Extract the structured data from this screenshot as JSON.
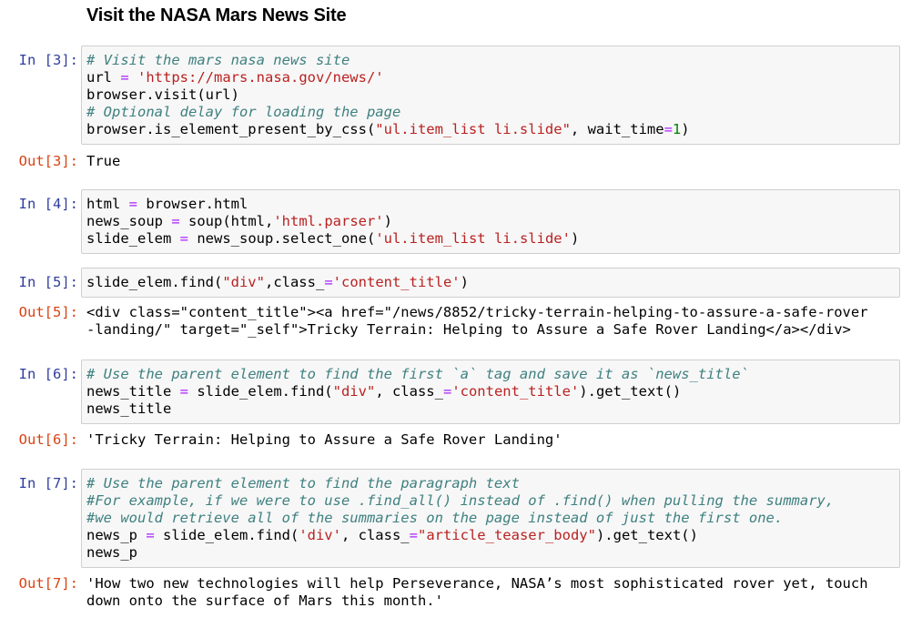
{
  "heading": "Visit the NASA Mars News Site",
  "cells": [
    {
      "in_prompt": "In [3]:",
      "code": [
        [
          {
            "t": "# Visit the mars nasa news site",
            "c": "cm"
          }
        ],
        [
          {
            "t": "url "
          },
          {
            "t": "=",
            "c": "op"
          },
          {
            "t": " "
          },
          {
            "t": "'https://mars.nasa.gov/news/'",
            "c": "st"
          }
        ],
        [
          {
            "t": "browser.visit(url)"
          }
        ],
        [
          {
            "t": "# Optional delay for loading the page",
            "c": "cm"
          }
        ],
        [
          {
            "t": "browser.is_element_present_by_css("
          },
          {
            "t": "\"ul.item_list li.slide\"",
            "c": "st"
          },
          {
            "t": ", wait_time"
          },
          {
            "t": "=",
            "c": "op"
          },
          {
            "t": "1",
            "c": "nm"
          },
          {
            "t": ")"
          }
        ]
      ],
      "out_prompt": "Out[3]:",
      "output": [
        "True"
      ]
    },
    {
      "in_prompt": "In [4]:",
      "code": [
        [
          {
            "t": "html "
          },
          {
            "t": "=",
            "c": "op"
          },
          {
            "t": " browser.html"
          }
        ],
        [
          {
            "t": "news_soup "
          },
          {
            "t": "=",
            "c": "op"
          },
          {
            "t": " soup(html,"
          },
          {
            "t": "'html.parser'",
            "c": "st"
          },
          {
            "t": ")"
          }
        ],
        [
          {
            "t": "slide_elem "
          },
          {
            "t": "=",
            "c": "op"
          },
          {
            "t": " news_soup.select_one("
          },
          {
            "t": "'ul.item_list li.slide'",
            "c": "st"
          },
          {
            "t": ")"
          }
        ]
      ],
      "out_prompt": "",
      "output": []
    },
    {
      "in_prompt": "In [5]:",
      "code": [
        [
          {
            "t": "slide_elem.find("
          },
          {
            "t": "\"div\"",
            "c": "st"
          },
          {
            "t": ",class_"
          },
          {
            "t": "=",
            "c": "op"
          },
          {
            "t": "'content_title'",
            "c": "st"
          },
          {
            "t": ")"
          }
        ]
      ],
      "out_prompt": "Out[5]:",
      "output": [
        "<div class=\"content_title\"><a href=\"/news/8852/tricky-terrain-helping-to-assure-a-safe-rover",
        "-landing/\" target=\"_self\">Tricky Terrain: Helping to Assure a Safe Rover Landing</a></div>"
      ]
    },
    {
      "in_prompt": "In [6]:",
      "code": [
        [
          {
            "t": "# Use the parent element to find the first `a` tag and save it as `news_title`",
            "c": "cm"
          }
        ],
        [
          {
            "t": "news_title "
          },
          {
            "t": "=",
            "c": "op"
          },
          {
            "t": " slide_elem.find("
          },
          {
            "t": "\"div\"",
            "c": "st"
          },
          {
            "t": ", class_"
          },
          {
            "t": "=",
            "c": "op"
          },
          {
            "t": "'content_title'",
            "c": "st"
          },
          {
            "t": ").get_text()"
          }
        ],
        [
          {
            "t": "news_title"
          }
        ]
      ],
      "out_prompt": "Out[6]:",
      "output": [
        "'Tricky Terrain: Helping to Assure a Safe Rover Landing'"
      ]
    },
    {
      "in_prompt": "In [7]:",
      "code": [
        [
          {
            "t": "# Use the parent element to find the paragraph text",
            "c": "cm"
          }
        ],
        [
          {
            "t": "#For example, if we were to use .find_all() instead of .find() when pulling the summary,",
            "c": "cm"
          }
        ],
        [
          {
            "t": "#we would retrieve all of the summaries on the page instead of just the first one.",
            "c": "cm"
          }
        ],
        [
          {
            "t": "news_p "
          },
          {
            "t": "=",
            "c": "op"
          },
          {
            "t": " slide_elem.find("
          },
          {
            "t": "'div'",
            "c": "st"
          },
          {
            "t": ", class_"
          },
          {
            "t": "=",
            "c": "op"
          },
          {
            "t": "\"article_teaser_body\"",
            "c": "st"
          },
          {
            "t": ").get_text()"
          }
        ],
        [
          {
            "t": "news_p"
          }
        ]
      ],
      "out_prompt": "Out[7]:",
      "output": [
        "'How two new technologies will help Perseverance, NASA’s most sophisticated rover yet, touch",
        "down onto the surface of Mars this month.'"
      ]
    }
  ]
}
